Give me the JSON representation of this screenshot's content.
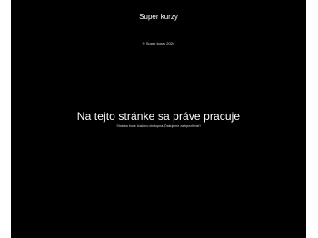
{
  "site": {
    "title": "Super kurzy",
    "copyright": "© Super kurzy 2024"
  },
  "maintenance": {
    "heading": "Na tejto stránke sa práve pracuje",
    "message": "Stránka bude čoskoro dostupná. Ďakujeme za trpezlivosť!"
  },
  "icons": {
    "admin_login": "lock-icon"
  },
  "colors": {
    "background": "#000000",
    "text": "#ffffff"
  }
}
